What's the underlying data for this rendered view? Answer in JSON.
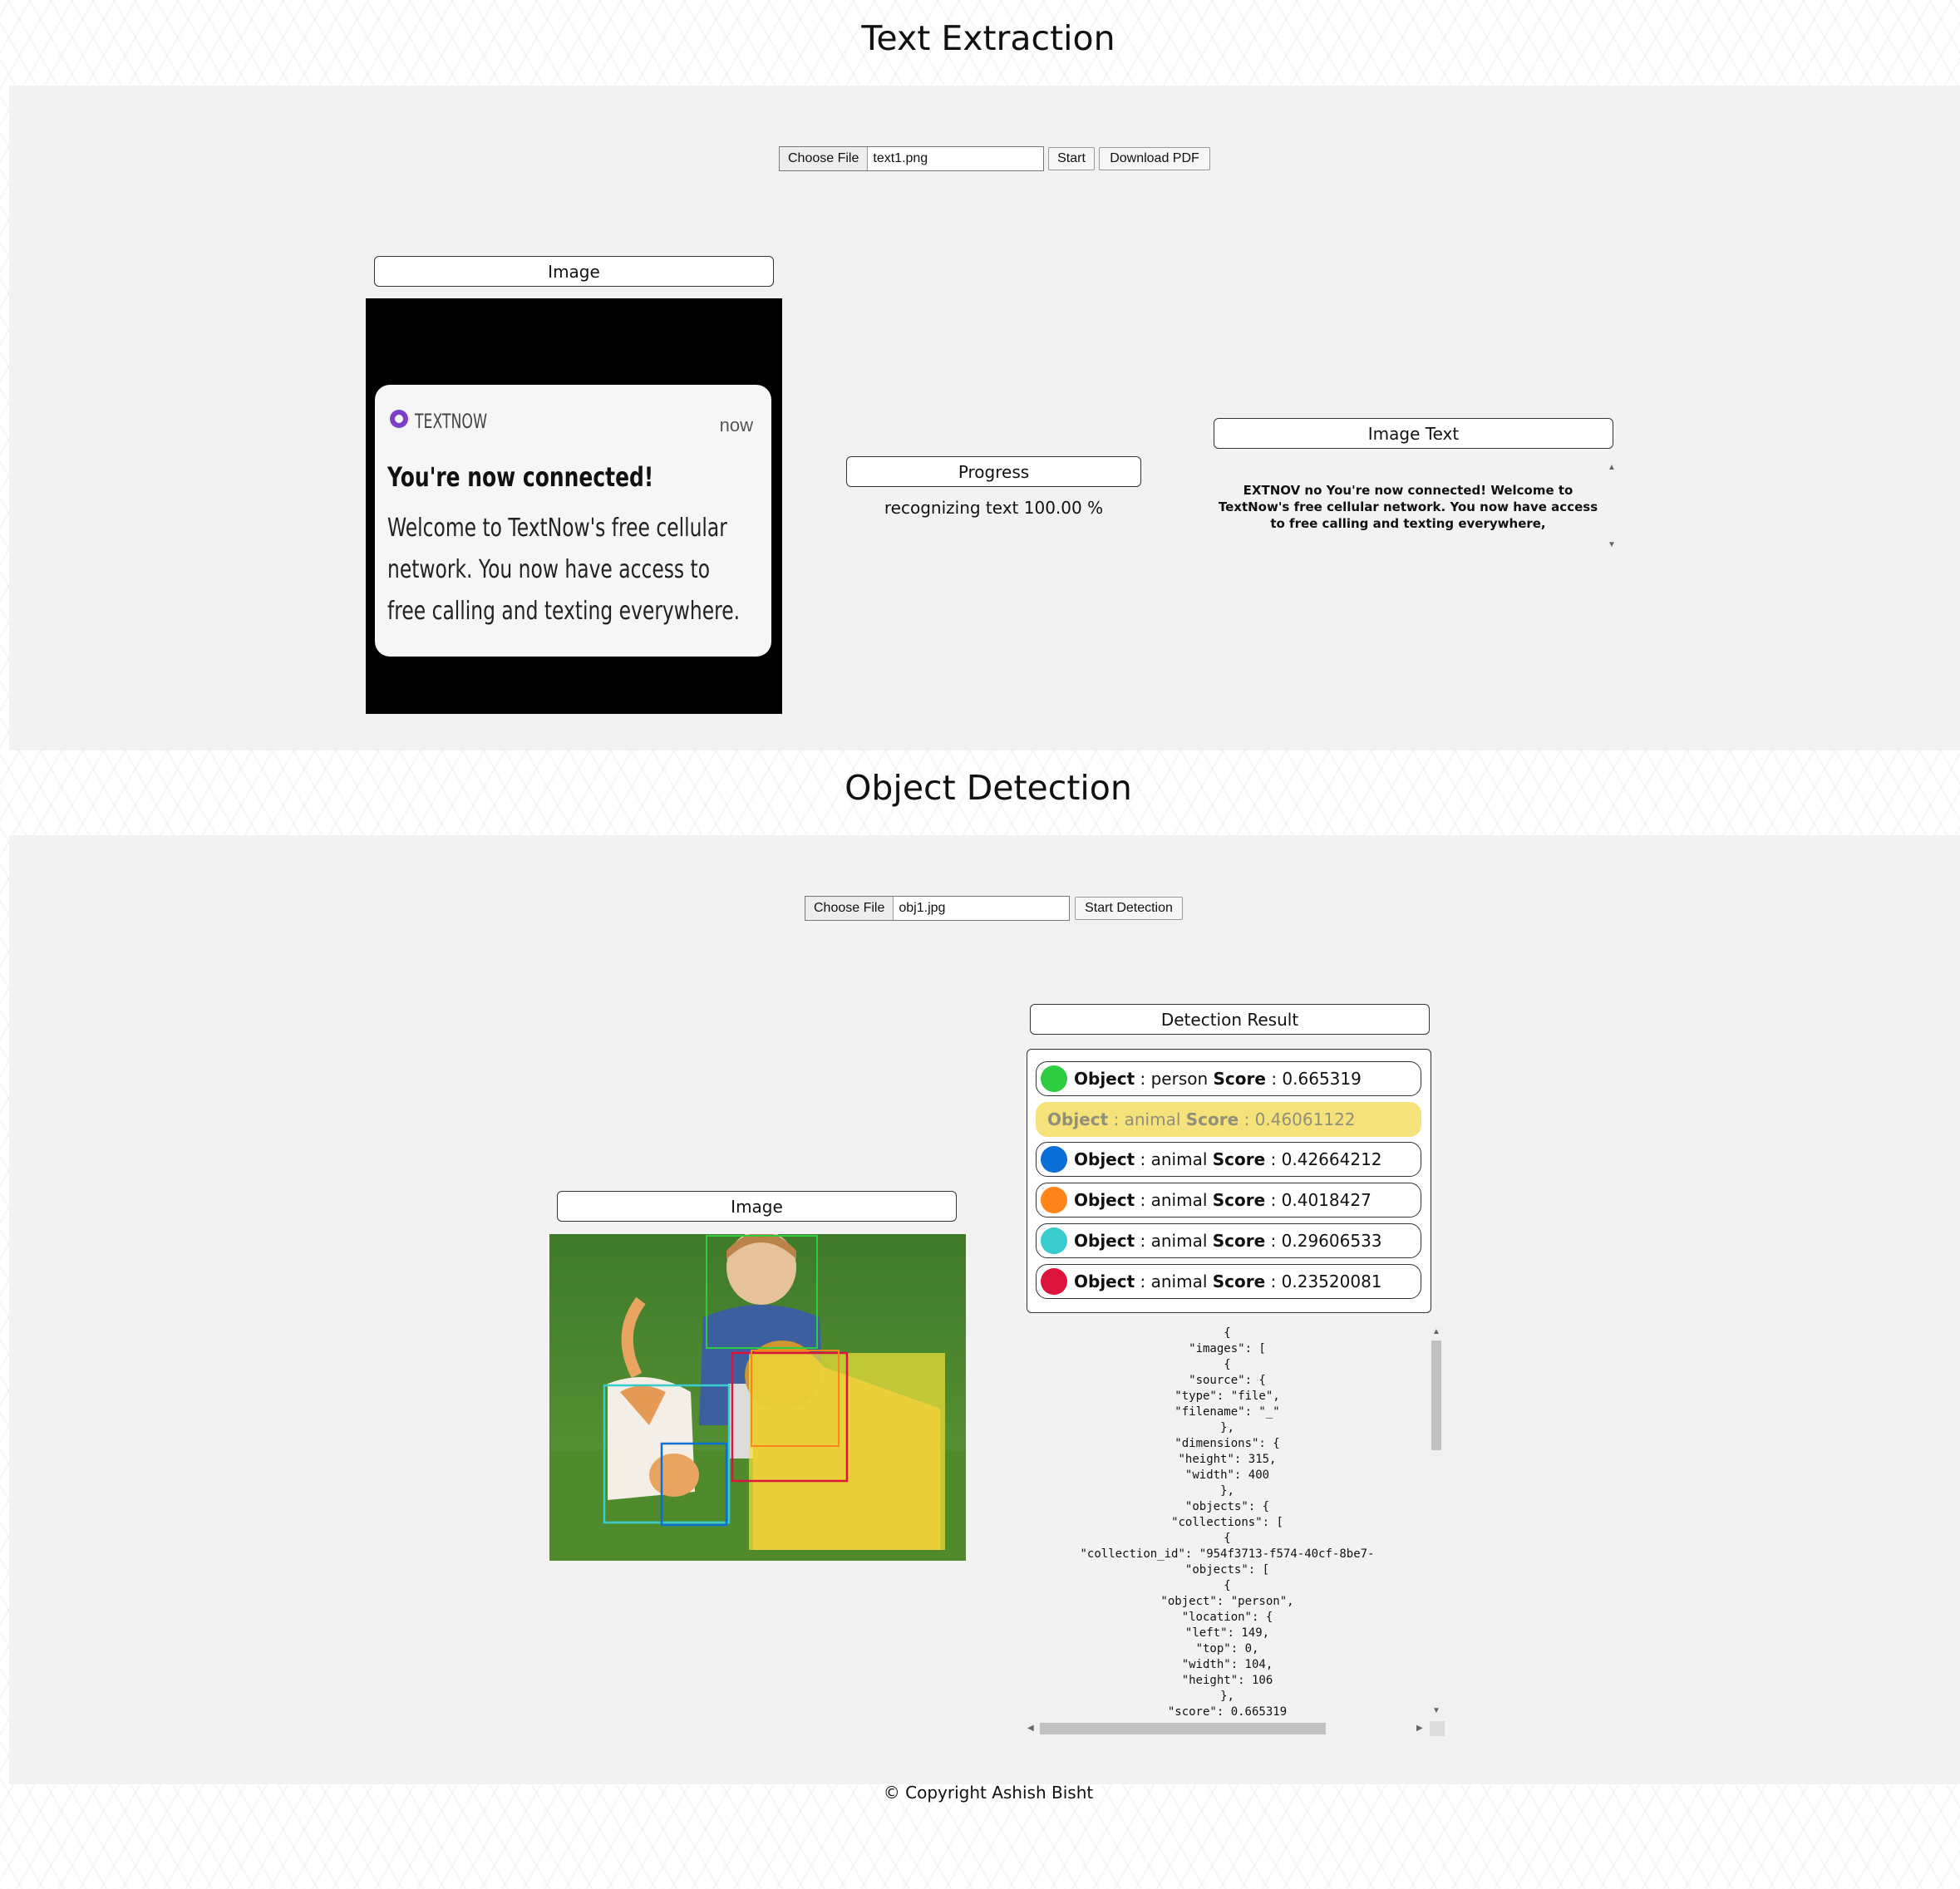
{
  "text_section": {
    "title": "Text Extraction",
    "file_button": "Choose File",
    "file_name": "text1.png",
    "start_button": "Start",
    "download_button": "Download PDF",
    "image_label": "Image",
    "progress_label": "Progress",
    "progress_text": "recognizing text 100.00 %",
    "image_text_label": "Image Text",
    "image_text": "EXTNOV no You're now connected! Welcome to TextNow's free cellular network. You now have access to free calling and texting everywhere,",
    "notification": {
      "brand": "TEXTNOW",
      "time": "now",
      "heading": "You're now connected!",
      "body": "Welcome to TextNow's free cellular network. You now have access to free calling and texting everywhere."
    }
  },
  "object_section": {
    "title": "Object Detection",
    "file_button": "Choose File",
    "file_name": "obj1.jpg",
    "detect_button": "Start Detection",
    "image_label": "Image",
    "result_label": "Detection Result",
    "key_object": "Object",
    "key_score": "Score",
    "results": [
      {
        "object": "person",
        "score": "0.665319",
        "color": "#2ecc40",
        "highlighted": false
      },
      {
        "object": "animal",
        "score": "0.46061122",
        "color": "#f6e27a",
        "highlighted": true
      },
      {
        "object": "animal",
        "score": "0.42664212",
        "color": "#0a6fd6",
        "highlighted": false
      },
      {
        "object": "animal",
        "score": "0.4018427",
        "color": "#ff851b",
        "highlighted": false
      },
      {
        "object": "animal",
        "score": "0.29606533",
        "color": "#39cccc",
        "highlighted": false
      },
      {
        "object": "animal",
        "score": "0.23520081",
        "color": "#dc143c",
        "highlighted": false
      }
    ],
    "json_lines": [
      "{",
      "\"images\": [",
      "{",
      "\"source\": {",
      "\"type\": \"file\",",
      "\"filename\": \"_\"",
      "},",
      "\"dimensions\": {",
      "\"height\": 315,",
      "\"width\": 400",
      "},",
      "\"objects\": {",
      "\"collections\": [",
      "{",
      "\"collection_id\": \"954f3713-f574-40cf-8be7-",
      "\"objects\": [",
      "{",
      "\"object\": \"person\",",
      "\"location\": {",
      "\"left\": 149,",
      "\"top\": 0,",
      "\"width\": 104,",
      "\"height\": 106",
      "},",
      "\"score\": 0.665319"
    ]
  },
  "footer": "© Copyright Ashish Bisht"
}
